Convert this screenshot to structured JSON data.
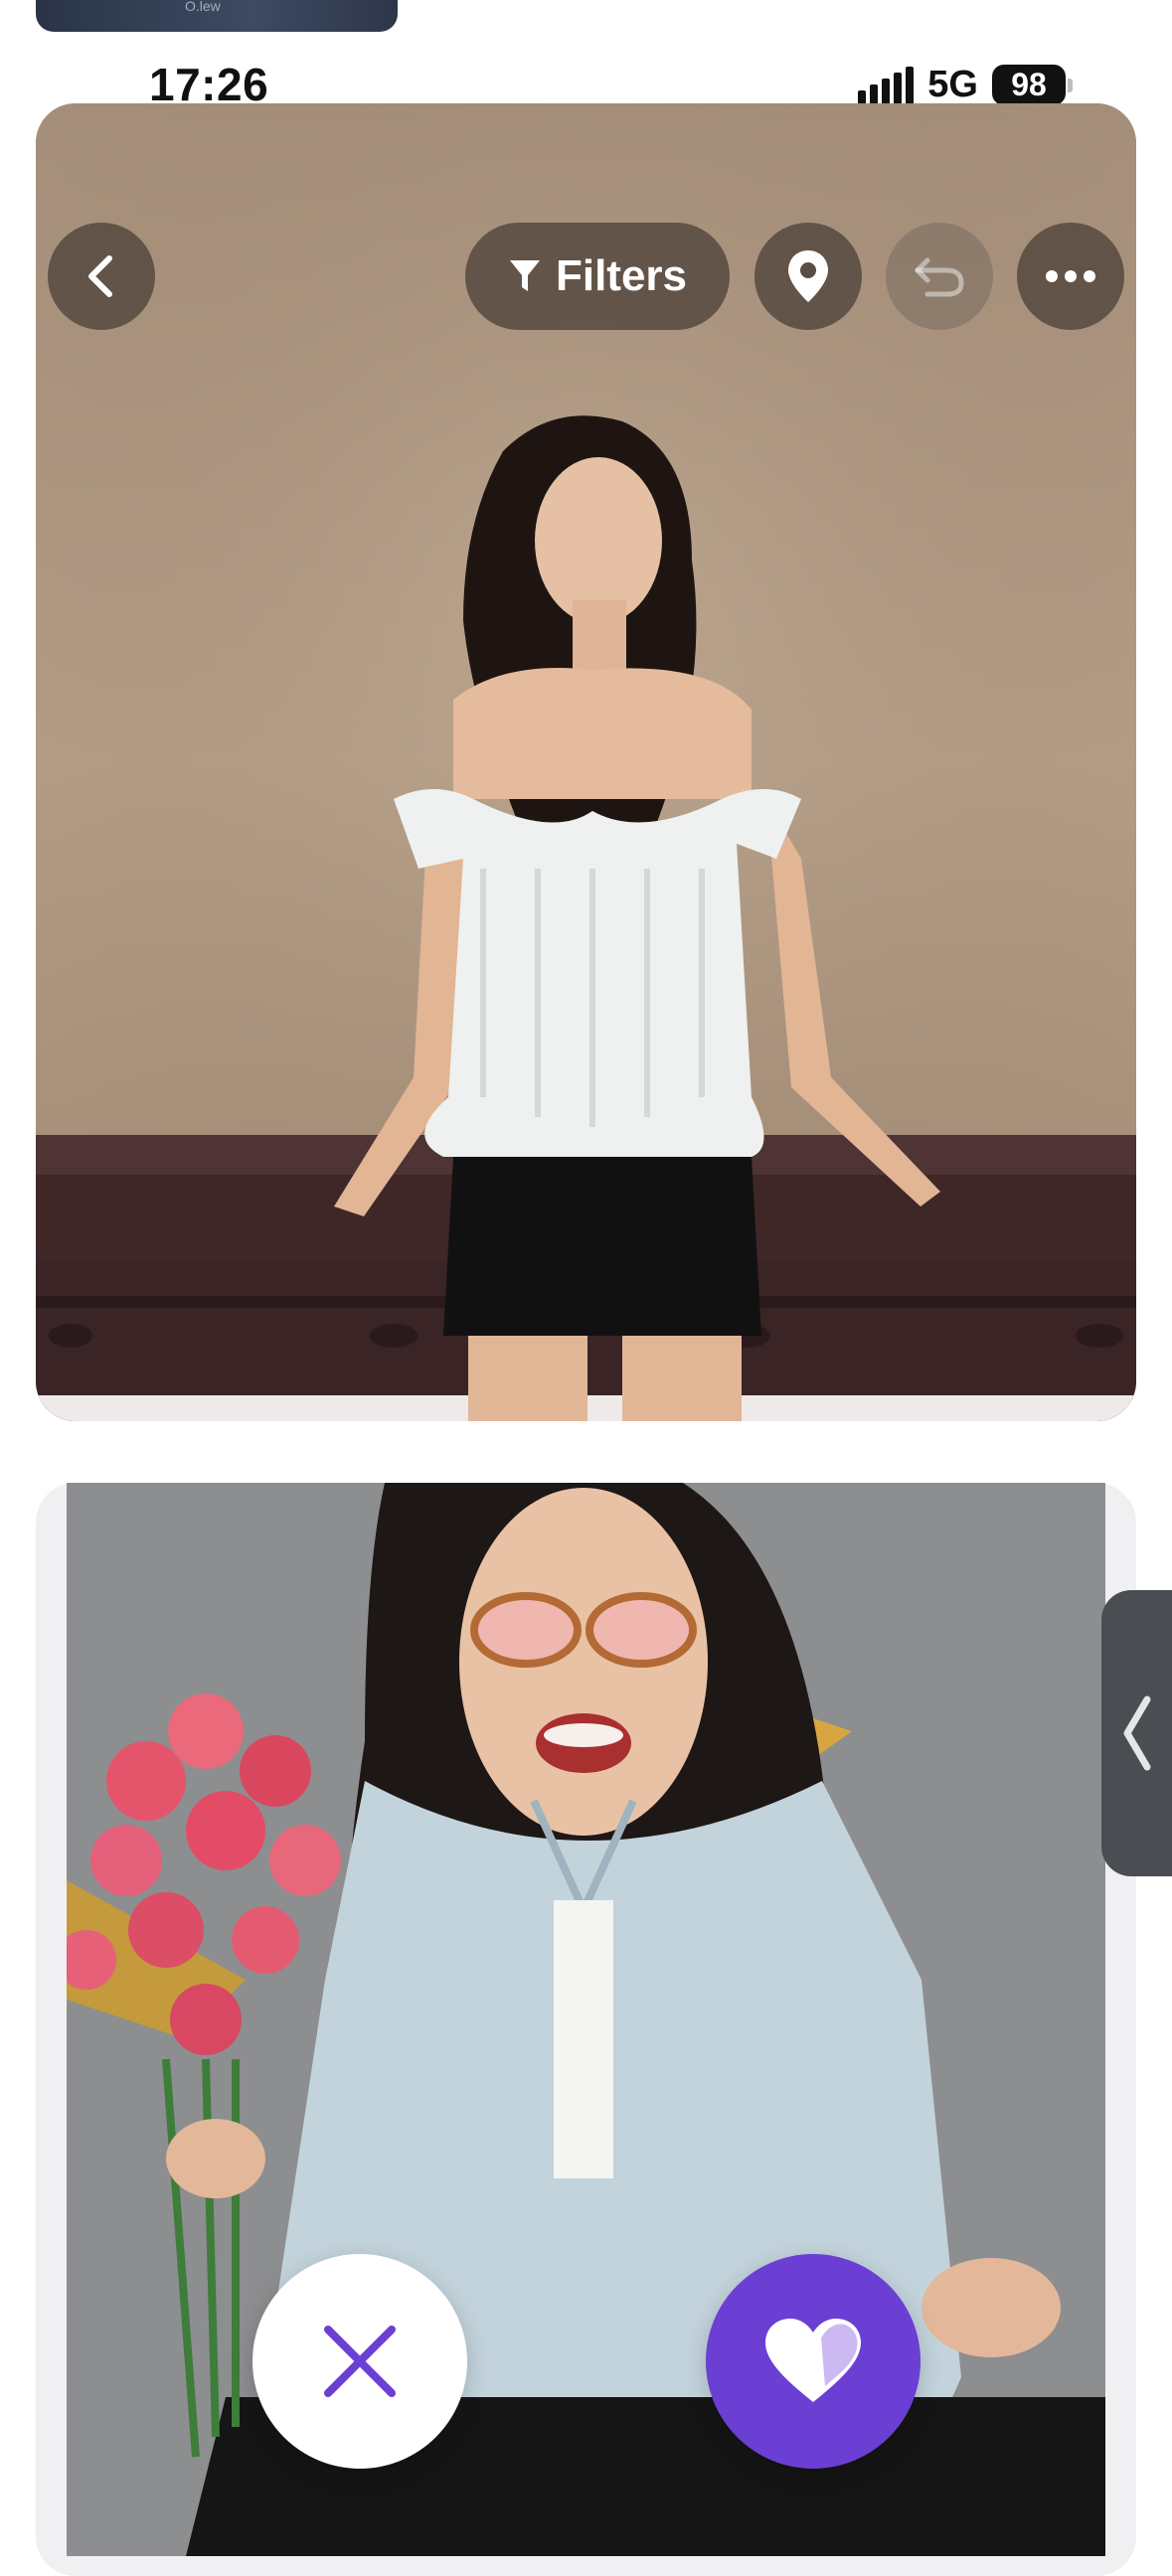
{
  "peek_card": {
    "text": "O.lew"
  },
  "status_bar": {
    "time": "17:26",
    "network": "5G",
    "battery": "98"
  },
  "toolbar": {
    "back_icon": "chevron-left-icon",
    "filters_label": "Filters",
    "filter_icon": "funnel-icon",
    "location_icon": "location-pin-icon",
    "undo_icon": "undo-icon",
    "more_icon": "ellipsis-icon"
  },
  "actions": {
    "dislike_icon": "close-icon",
    "like_icon": "heart-icon"
  },
  "colors": {
    "accent": "#6b3fd4",
    "overlay_button": "#463c34"
  }
}
